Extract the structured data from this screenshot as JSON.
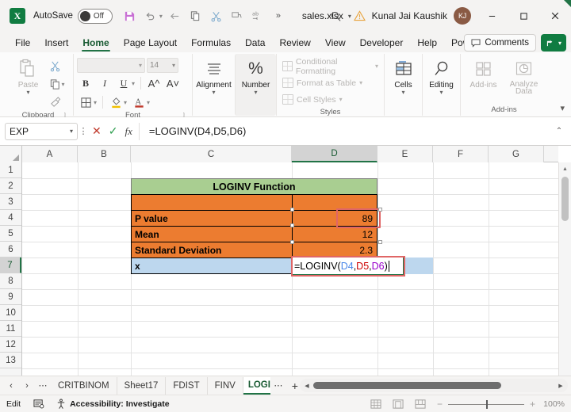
{
  "titlebar": {
    "app_logo": "excel-logo",
    "autosave_label": "AutoSave",
    "autosave_state": "Off",
    "quick_access": [
      {
        "name": "save-icon",
        "label": "Save"
      },
      {
        "name": "undo-icon",
        "label": "Undo"
      },
      {
        "name": "redo-icon",
        "label": "Redo"
      },
      {
        "name": "copy-icon",
        "label": "Copy"
      },
      {
        "name": "cut-icon",
        "label": "Cut"
      },
      {
        "name": "format-painter-icon",
        "label": "Format Painter"
      },
      {
        "name": "spelling-icon",
        "label": "Spelling"
      },
      {
        "name": "more-icon",
        "label": "More"
      }
    ],
    "filename": "sales.xlsx",
    "search_placeholder": "Search",
    "user_name": "Kunal Jai Kaushik",
    "user_initials": "KJ",
    "minimize": "–",
    "maximize": "□",
    "close": "✕"
  },
  "ribbon_tabs": {
    "items": [
      "File",
      "Insert",
      "Home",
      "Page Layout",
      "Formulas",
      "Data",
      "Review",
      "View",
      "Developer",
      "Help",
      "Power Pivot"
    ],
    "active": "Home",
    "comments_label": "Comments",
    "share_label": "Share"
  },
  "ribbon": {
    "clipboard": {
      "group_label": "Clipboard",
      "paste_label": "Paste",
      "cut_label": "Cut",
      "copy_label": "Copy",
      "format_painter_label": "Format Painter"
    },
    "font": {
      "group_label": "Font",
      "font_name": "",
      "font_size": "14",
      "bold": "B",
      "italic": "I",
      "underline": "U",
      "grow_font": "A",
      "shrink_font": "A",
      "borders": "borders-icon",
      "fill_color": "fill-color-icon",
      "font_color": "font-color-icon"
    },
    "alignment": {
      "group_label": "Alignment",
      "label": "Alignment"
    },
    "number": {
      "group_label": "Number",
      "label": "Number",
      "symbol": "%"
    },
    "styles": {
      "group_label": "Styles",
      "conditional_formatting": "Conditional Formatting",
      "format_as_table": "Format as Table",
      "cell_styles": "Cell Styles"
    },
    "cells": {
      "label": "Cells"
    },
    "editing": {
      "label": "Editing"
    },
    "addins": {
      "group_label": "Add-ins",
      "addins_label": "Add-ins",
      "analyze_line1": "Analyze",
      "analyze_line2": "Data"
    }
  },
  "formula_bar": {
    "name_box": "EXP",
    "cancel_icon": "✕",
    "enter_icon": "✓",
    "function_icon": "fx",
    "formula": "=LOGINV(D4,D5,D6)",
    "expand_icon": "⌃"
  },
  "grid": {
    "columns": [
      "A",
      "B",
      "C",
      "D",
      "E",
      "F",
      "G"
    ],
    "active_column": "D",
    "rows": [
      "1",
      "2",
      "3",
      "4",
      "5",
      "6",
      "7",
      "8",
      "9",
      "10",
      "11",
      "12",
      "13"
    ],
    "active_row": "7",
    "cells": {
      "C2": "LOGINV Function",
      "C4": "P value",
      "D4": "89",
      "C5": "Mean",
      "D5": "12",
      "C6": "Standard Deviation",
      "D6": "2.3",
      "C7": "x"
    },
    "editing_cell": {
      "address": "D7",
      "text_prefix": "=LOGINV(",
      "ref1": "D4",
      "sep1": ",",
      "ref2": "D5",
      "sep2": ",",
      "ref3": "D6",
      "text_suffix": ")"
    },
    "colors": {
      "title_fill": "#a9ce91",
      "data_fill": "#ec7c30",
      "selected_row_fill": "#bdd7ee",
      "marching_ants": "#e06666",
      "ref1_color": "#4a86e8",
      "ref2_color": "#cc0000",
      "ref3_color": "#9900cc",
      "accent": "#217346"
    }
  },
  "sheet_bar": {
    "first_icon": "‹",
    "prev_icon": "‹",
    "next_icon": "›",
    "more_icon": "⋯",
    "tabs": [
      "CRITBINOM",
      "Sheet17",
      "FDIST",
      "FINV",
      "LOGINV"
    ],
    "active_tab": "LOGINV",
    "overflow_icon": "⋯",
    "add_sheet_icon": "+",
    "options_icon": "⋮"
  },
  "status_bar": {
    "mode": "Edit",
    "recording_icon": "macro-record-icon",
    "accessibility_icon": "accessibility-icon",
    "accessibility_text": "Accessibility: Investigate",
    "view_normal": "normal-view-icon",
    "view_page_layout": "page-layout-view-icon",
    "view_page_break": "page-break-view-icon",
    "zoom_out": "−",
    "zoom_in": "+",
    "zoom_level": "100%"
  }
}
